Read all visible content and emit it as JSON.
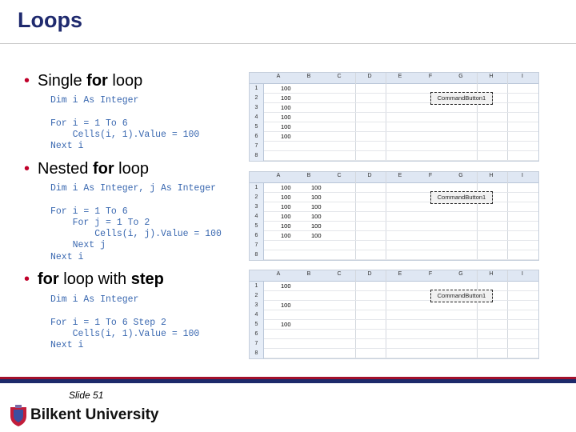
{
  "title": "Loops",
  "sections": [
    {
      "bullet_pre": "Single ",
      "bullet_bold": "for",
      "bullet_post": " loop",
      "code": "Dim i As Integer\n\nFor i = 1 To 6\n    Cells(i, 1).Value = 100\nNext i",
      "cells": [
        [
          "100",
          ""
        ],
        [
          "100",
          ""
        ],
        [
          "100",
          ""
        ],
        [
          "100",
          ""
        ],
        [
          "100",
          ""
        ],
        [
          "100",
          ""
        ],
        [
          "",
          ""
        ],
        [
          "",
          ""
        ]
      ]
    },
    {
      "bullet_pre": "Nested ",
      "bullet_bold": "for",
      "bullet_post": " loop",
      "code": "Dim i As Integer, j As Integer\n\nFor i = 1 To 6\n    For j = 1 To 2\n        Cells(i, j).Value = 100\n    Next j\nNext i",
      "cells": [
        [
          "100",
          "100"
        ],
        [
          "100",
          "100"
        ],
        [
          "100",
          "100"
        ],
        [
          "100",
          "100"
        ],
        [
          "100",
          "100"
        ],
        [
          "100",
          "100"
        ],
        [
          "",
          ""
        ],
        [
          "",
          ""
        ]
      ]
    },
    {
      "bullet_pre": "",
      "bullet_bold": "for",
      "bullet_post": " loop with ",
      "bullet_bold2": "step",
      "code": "Dim i As Integer\n\nFor i = 1 To 6 Step 2\n    Cells(i, 1).Value = 100\nNext i",
      "cells": [
        [
          "100",
          ""
        ],
        [
          "",
          ""
        ],
        [
          "100",
          ""
        ],
        [
          "",
          ""
        ],
        [
          "100",
          ""
        ],
        [
          "",
          ""
        ],
        [
          "",
          ""
        ],
        [
          "",
          ""
        ]
      ]
    }
  ],
  "sheet": {
    "columns": [
      "A",
      "B",
      "C",
      "D",
      "E",
      "F",
      "G",
      "H",
      "I"
    ],
    "rows": [
      "1",
      "2",
      "3",
      "4",
      "5",
      "6",
      "7",
      "8"
    ],
    "button_label": "CommandButton1"
  },
  "footer": {
    "slide": "Slide 51",
    "university": "Bilkent University"
  },
  "colors": {
    "title": "#1f2a6e",
    "code": "#3a68b0",
    "bullet": "#c0002a",
    "bar_red": "#a3102b",
    "bar_blue": "#1d2a6b"
  }
}
